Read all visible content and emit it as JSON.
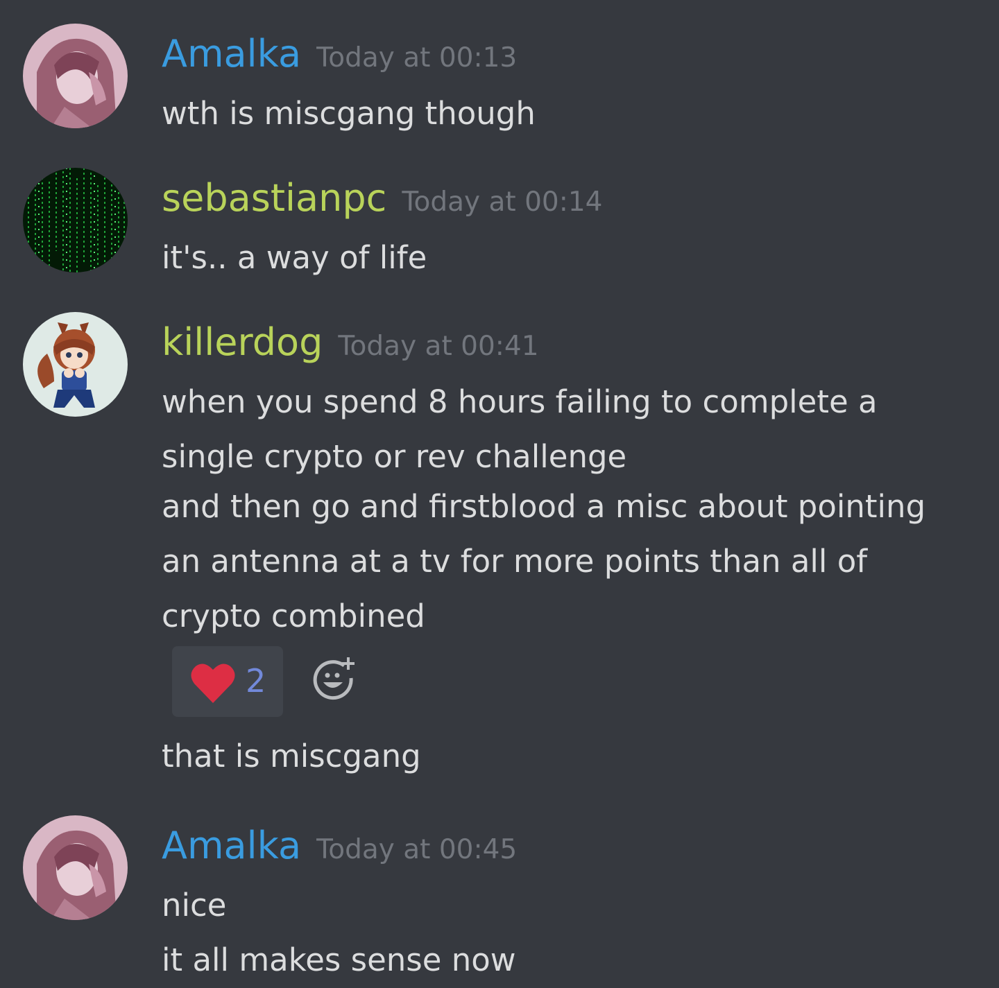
{
  "colors": {
    "background": "#36393f",
    "amalka": "#3a9ce0",
    "sebastianpc": "#b9d35a",
    "killerdog": "#b9d35a",
    "timestamp": "#72767d",
    "text": "#dcddde",
    "reaction_bg": "#40444b",
    "reaction_count": "#7289da"
  },
  "messages": [
    {
      "author": "Amalka",
      "timestamp": "Today at 00:13",
      "avatar_icon": "anime-girl-avatar",
      "lines": [
        "wth is miscgang though"
      ]
    },
    {
      "author": "sebastianpc",
      "timestamp": "Today at 00:14",
      "avatar_icon": "matrix-code-avatar",
      "lines": [
        "it's.. a way of life"
      ]
    },
    {
      "author": "killerdog",
      "timestamp": "Today at 00:41",
      "avatar_icon": "chibi-foxgirl-avatar",
      "lines": [
        "when you spend 8 hours failing to complete a",
        "single crypto or rev challenge",
        "and then go and firstblood a misc about pointing",
        "an antenna at a tv for more points than all of",
        "crypto combined"
      ],
      "reaction": {
        "emoji": "heart-icon",
        "count": "2"
      },
      "followup": [
        "that is miscgang"
      ]
    },
    {
      "author": "Amalka",
      "timestamp": "Today at 00:45",
      "avatar_icon": "anime-girl-avatar",
      "lines": [
        "nice",
        "it all makes sense now"
      ]
    }
  ]
}
